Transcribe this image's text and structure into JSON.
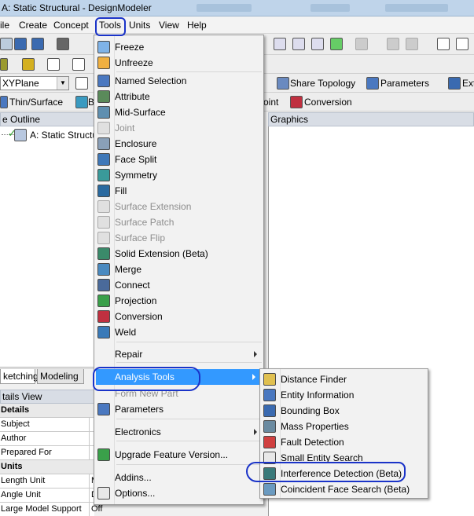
{
  "window": {
    "title": "A: Static Structural - DesignModeler"
  },
  "menubar": [
    "ile",
    "Create",
    "Concept",
    "Tools",
    "Units",
    "View",
    "Help"
  ],
  "toolbar": {
    "plane_value": "XYPlane",
    "share_topology": "Share Topology",
    "parameters": "Parameters",
    "ext_cut": "Ext",
    "thin_surface": "Thin/Surface",
    "b_cut": "B",
    "point_cut": "oint",
    "conversion": "Conversion"
  },
  "tree": {
    "header": "e Outline",
    "root": "A: Static Structu"
  },
  "graphics": {
    "header": "Graphics"
  },
  "tabs": [
    "ketching",
    "Modeling"
  ],
  "details": {
    "header": "tails View",
    "rows": [
      {
        "label": "Details",
        "value": "",
        "group": true
      },
      {
        "label": "Subject",
        "value": "",
        "group": false
      },
      {
        "label": "Author",
        "value": "",
        "group": false
      },
      {
        "label": "Prepared For",
        "value": "",
        "group": false
      },
      {
        "label": "Units",
        "value": "",
        "group": true
      },
      {
        "label": "Length Unit",
        "value": "M",
        "group": false
      },
      {
        "label": "Angle Unit",
        "value": "D",
        "group": false
      },
      {
        "label": "Large Model Support",
        "value": "Off",
        "group": false
      }
    ]
  },
  "tools_menu": {
    "items": [
      {
        "label": "Freeze",
        "icon": "freeze-icon",
        "color": "#7fb3e8",
        "disabled": false
      },
      {
        "label": "Unfreeze",
        "icon": "unfreeze-icon",
        "color": "#f0b040",
        "disabled": false
      },
      {
        "label": "Named Selection",
        "icon": "named-selection-icon",
        "color": "#4a78c0",
        "disabled": false
      },
      {
        "label": "Attribute",
        "icon": "attribute-icon",
        "color": "#5a8a5a",
        "disabled": false
      },
      {
        "label": "Mid-Surface",
        "icon": "mid-surface-icon",
        "color": "#5f8fb0",
        "disabled": false
      },
      {
        "label": "Joint",
        "icon": "joint-icon",
        "color": "#c0c0c0",
        "disabled": true
      },
      {
        "label": "Enclosure",
        "icon": "enclosure-icon",
        "color": "#8aa0b8",
        "disabled": false
      },
      {
        "label": "Face Split",
        "icon": "face-split-icon",
        "color": "#3f78b8",
        "disabled": false
      },
      {
        "label": "Symmetry",
        "icon": "symmetry-icon",
        "color": "#3a9a9a",
        "disabled": false
      },
      {
        "label": "Fill",
        "icon": "fill-icon",
        "color": "#2a6aa0",
        "disabled": false
      },
      {
        "label": "Surface Extension",
        "icon": "surface-extension-icon",
        "color": "#c0c0c0",
        "disabled": true
      },
      {
        "label": "Surface Patch",
        "icon": "surface-patch-icon",
        "color": "#c0c0c0",
        "disabled": true
      },
      {
        "label": "Surface Flip",
        "icon": "surface-flip-icon",
        "color": "#c0c0c0",
        "disabled": true
      },
      {
        "label": "Solid Extension (Beta)",
        "icon": "solid-extension-icon",
        "color": "#3a8a6a",
        "disabled": false
      },
      {
        "label": "Merge",
        "icon": "merge-icon",
        "color": "#4a8ac0",
        "disabled": false
      },
      {
        "label": "Connect",
        "icon": "connect-icon",
        "color": "#4a6a9a",
        "disabled": false
      },
      {
        "label": "Projection",
        "icon": "projection-icon",
        "color": "#3aa04a",
        "disabled": false
      },
      {
        "label": "Conversion",
        "icon": "conversion-icon",
        "color": "#c03040",
        "disabled": false
      },
      {
        "label": "Weld",
        "icon": "weld-icon",
        "color": "#3a7ab8",
        "disabled": false
      },
      {
        "label": "Repair",
        "icon": "",
        "color": "",
        "disabled": false,
        "submenu": true
      },
      {
        "label": "Analysis Tools",
        "icon": "",
        "color": "",
        "disabled": false,
        "submenu": true,
        "highlighted": true
      },
      {
        "label": "Form New Part",
        "icon": "",
        "color": "",
        "disabled": true
      },
      {
        "label": "Parameters",
        "icon": "parameters-icon",
        "color": "#4a78c0",
        "disabled": false
      },
      {
        "label": "Electronics",
        "icon": "",
        "color": "",
        "disabled": false,
        "submenu": true
      },
      {
        "label": "Upgrade Feature Version...",
        "icon": "upgrade-feature-icon",
        "color": "#3aa04a",
        "disabled": false
      },
      {
        "label": "Addins...",
        "icon": "",
        "color": "",
        "disabled": false
      },
      {
        "label": "Options...",
        "icon": "options-icon",
        "color": "#e8e8e8",
        "disabled": false
      }
    ]
  },
  "analysis_menu": {
    "items": [
      {
        "label": "Distance Finder",
        "icon": "ruler-icon",
        "color": "#e0c050"
      },
      {
        "label": "Entity Information",
        "icon": "info-icon",
        "color": "#4a78c0"
      },
      {
        "label": "Bounding Box",
        "icon": "bounding-box-icon",
        "color": "#3a6ab0"
      },
      {
        "label": "Mass Properties",
        "icon": "mass-properties-icon",
        "color": "#6a8aa0"
      },
      {
        "label": "Fault Detection",
        "icon": "fault-detection-icon",
        "color": "#d04040"
      },
      {
        "label": "Small Entity Search",
        "icon": "magnifier-icon",
        "color": "#e8e8e8"
      },
      {
        "label": "Interference Detection (Beta)",
        "icon": "interference-detection-icon",
        "color": "#3a7a7a"
      },
      {
        "label": "Coincident Face Search (Beta)",
        "icon": "coincident-face-icon",
        "color": "#6a9ac0"
      }
    ]
  },
  "colors": {
    "highlight": "#3399ff",
    "annotation": "#1a33c8"
  }
}
